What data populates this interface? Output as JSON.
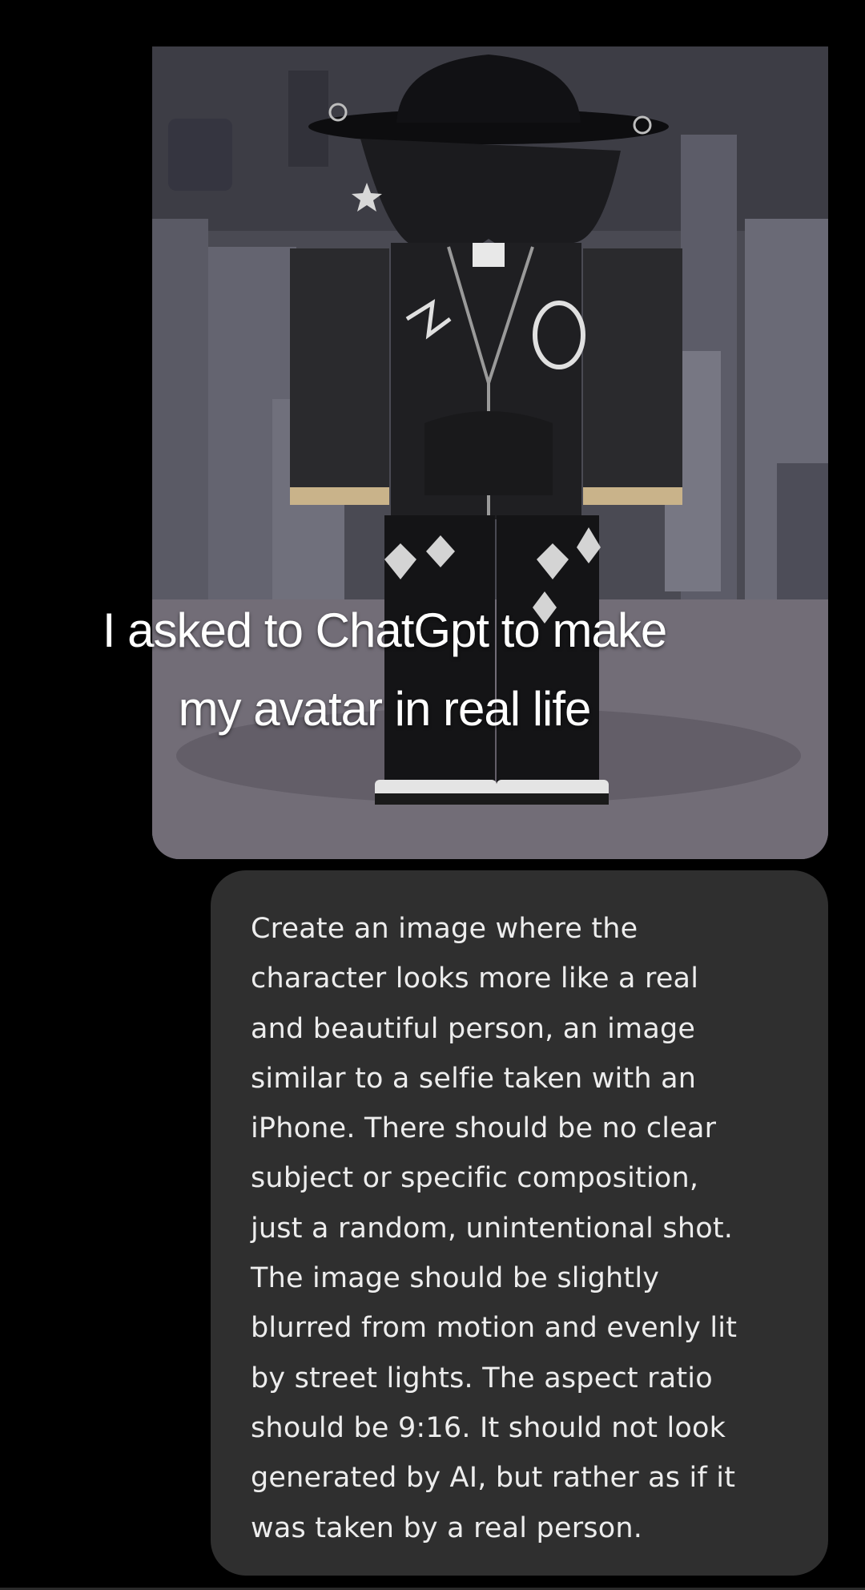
{
  "image": {
    "description_icon": "avatar-image"
  },
  "caption": {
    "line1": "I asked to ChatGpt to make",
    "line2": "my avatar in real life"
  },
  "prompt": {
    "lines": [
      "Create an image where the",
      "character looks more like a real",
      "and beautiful person, an image",
      "similar to a selfie taken with an",
      "iPhone. There should be no clear",
      "subject or specific composition,",
      "just a random, unintentional shot.",
      "The image should be slightly",
      "blurred from motion and evenly lit",
      "by street lights. The aspect ratio",
      "should be 9:16. It should not look",
      "generated by AI, but rather as if it",
      "was taken by a real person."
    ]
  },
  "colors": {
    "background": "#000000",
    "bubble": "#2f2f2f",
    "text": "#ededed"
  }
}
